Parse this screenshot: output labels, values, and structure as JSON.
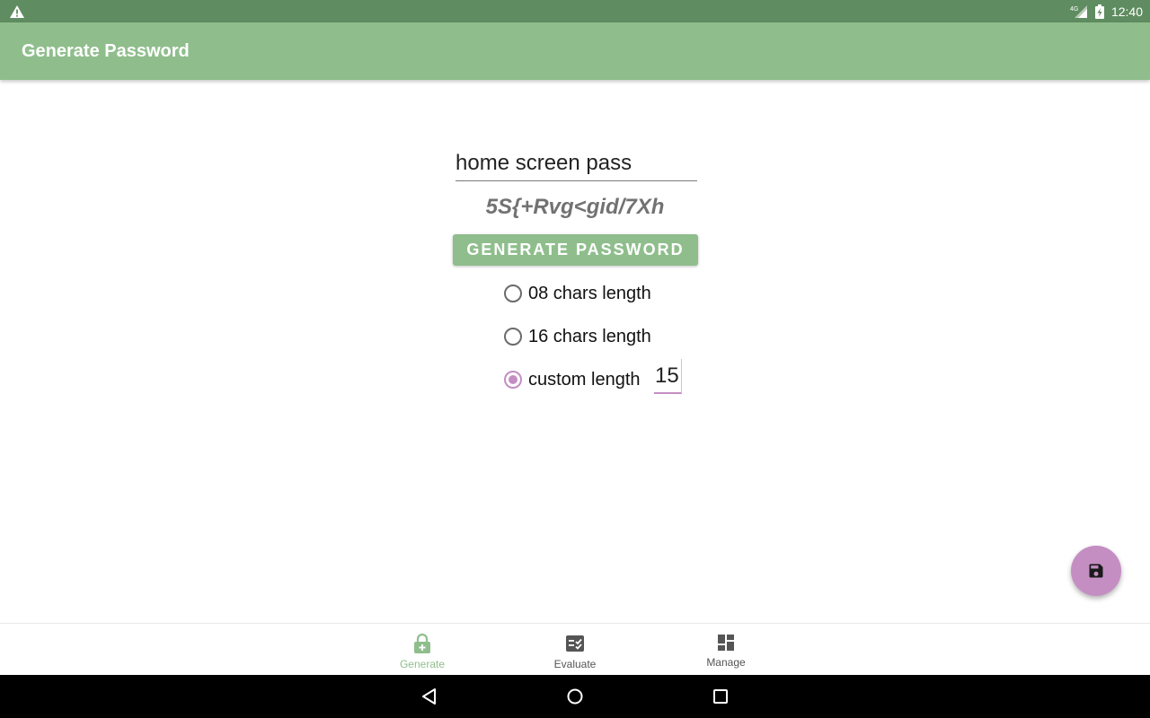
{
  "status_bar": {
    "time": "12:40",
    "network": "4G"
  },
  "app_bar": {
    "title": "Generate Password"
  },
  "form": {
    "name_value": "home screen pass",
    "generated_password": "5S{+Rvg<gid/7Xh",
    "generate_button_label": "GENERATE PASSWORD",
    "length_options": [
      {
        "label": "08 chars length",
        "checked": false
      },
      {
        "label": "16 chars length",
        "checked": false
      },
      {
        "label": "custom length",
        "checked": true
      }
    ],
    "custom_length_value": "15"
  },
  "fab": {
    "icon": "save-icon"
  },
  "bottom_nav": {
    "items": [
      {
        "label": "Generate",
        "icon": "lock-add-icon",
        "active": true
      },
      {
        "label": "Evaluate",
        "icon": "checklist-icon",
        "active": false
      },
      {
        "label": "Manage",
        "icon": "dashboard-icon",
        "active": false
      }
    ]
  },
  "colors": {
    "status_bar": "#5f8d61",
    "primary": "#8fbe8c",
    "accent": "#c48ec3",
    "password_text": "#727272"
  }
}
